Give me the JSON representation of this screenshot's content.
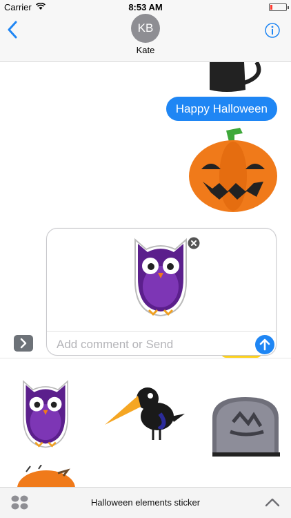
{
  "status": {
    "carrier": "Carrier",
    "time": "8:53 AM"
  },
  "header": {
    "avatar_initials": "KB",
    "contact_name": "Kate"
  },
  "messages": [
    {
      "text": "Happy Halloween",
      "sender": "me"
    }
  ],
  "composer": {
    "placeholder": "Add comment or Send"
  },
  "bottom_bar": {
    "title": "Halloween elements sticker"
  },
  "icons": {
    "back": "chevron-left-icon",
    "info": "info-icon",
    "send": "arrow-up-icon",
    "expand": "chevron-right-icon",
    "apps": "app-grid-icon",
    "collapse": "chevron-up-icon"
  },
  "colors": {
    "accent": "#1f86f4",
    "owl": "#5b1f8c",
    "pumpkin": "#f07a1a"
  }
}
